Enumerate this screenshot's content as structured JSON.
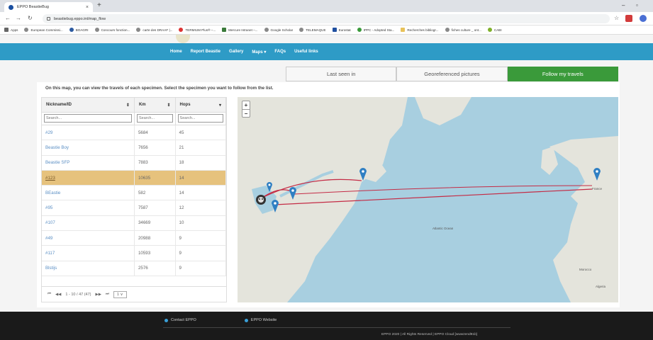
{
  "browser": {
    "tab_title": "EPPO BeastieBug",
    "tab_close": "×",
    "new_tab": "+",
    "url": "beastiebug.eppo.int/map_flow",
    "bookmarks": [
      "Apps",
      "European Commissi...",
      "BOAGRI",
      "Concours fonction...",
      "carte des DRAAF |...",
      "TERMIUM Plus® –...",
      "Mercure Intranet –...",
      "Google Scholar",
      "TELEMAQUE",
      "Eurostat",
      "IPPC - Adopted Sta...",
      "Recherches bibliogr...",
      "fiches culture _ ont...",
      "CABI"
    ]
  },
  "nav": {
    "items": [
      "Home",
      "Report Beastie",
      "Gallery",
      "Maps ▾",
      "FAQs",
      "Useful links"
    ]
  },
  "view_tabs": [
    "Last seen in",
    "Georeferenced pictures",
    "Follow my travels"
  ],
  "intro_text": "On this map, you can view the travels of each specimen. Select the specimen you want to follow from the list.",
  "table": {
    "headers": [
      "Nickname/ID",
      "Km",
      "Hops"
    ],
    "placeholders": [
      "Search...",
      "Search...",
      "Search..."
    ],
    "rows": [
      [
        "#29",
        "5684",
        "45"
      ],
      [
        "Beastie Boy",
        "7656",
        "21"
      ],
      [
        "Beastie SFP",
        "7883",
        "18"
      ],
      [
        "#123",
        "10635",
        "14"
      ],
      [
        "BEastie",
        "582",
        "14"
      ],
      [
        "#95",
        "7587",
        "12"
      ],
      [
        "#107",
        "34669",
        "10"
      ],
      [
        "#49",
        "20988",
        "9"
      ],
      [
        "#117",
        "10593",
        "9"
      ],
      [
        "Blstijs",
        "2576",
        "9"
      ]
    ],
    "pager": {
      "first": "⏮",
      "prev": "◀◀",
      "info": "1 - 10 / 47 (47)",
      "next": "▶▶",
      "last": "⏭",
      "page": "1 ∨"
    }
  },
  "map": {
    "zoom_in": "+",
    "zoom_out": "−",
    "labels": [
      "Atlantic Ocean",
      "France",
      "Morocco",
      "Algeria"
    ]
  },
  "footer": {
    "links": [
      "Contact EPPO",
      "EPPO Website"
    ],
    "copyright": "EPPO 2020 | All Rights Reserved | EPPO Cloud [wwwzend91b]"
  }
}
